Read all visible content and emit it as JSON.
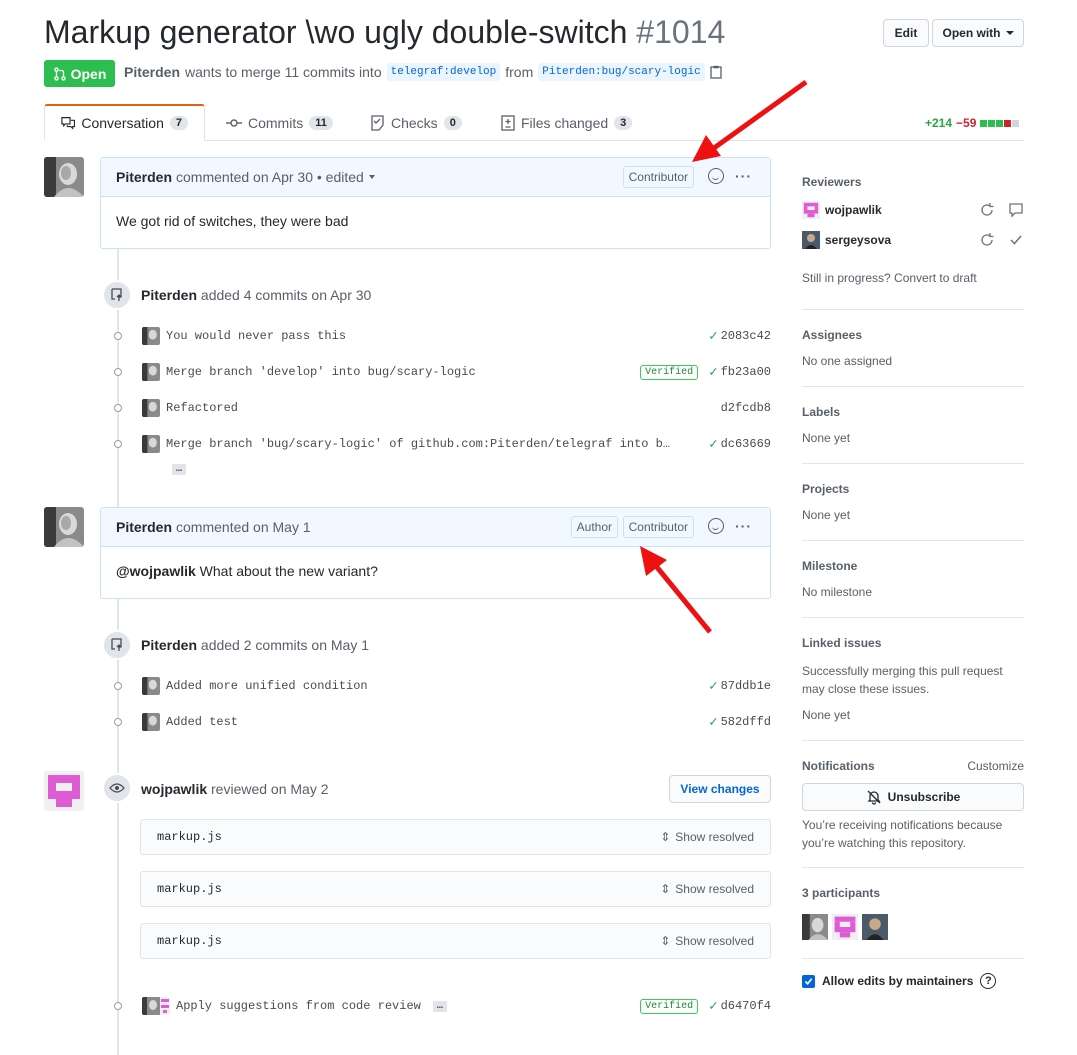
{
  "header": {
    "title": "Markup generator \\wo ugly double-switch",
    "number": "#1014",
    "edit_label": "Edit",
    "open_with_label": "Open with"
  },
  "pr": {
    "state": "Open",
    "author": "Piterden",
    "merge_text": "wants to merge 11 commits into",
    "base_branch": "telegraf:develop",
    "from_text": "from",
    "head_branch": "Piterden:bug/scary-logic"
  },
  "tabs": [
    {
      "label": "Conversation",
      "count": "7"
    },
    {
      "label": "Commits",
      "count": "11"
    },
    {
      "label": "Checks",
      "count": "0"
    },
    {
      "label": "Files changed",
      "count": "3"
    }
  ],
  "diffstat": {
    "additions": "+214",
    "deletions": "−59"
  },
  "timeline": {
    "comment1": {
      "author": "Piterden",
      "meta": "commented on Apr 30 • edited",
      "role": "Contributor",
      "body": "We got rid of switches, they were bad"
    },
    "event1": {
      "author": "Piterden",
      "text": "added 4 commits on Apr 30"
    },
    "commits1": [
      {
        "message": "You would never pass this",
        "sha": "2083c42",
        "verified": "",
        "check": "✓"
      },
      {
        "message": "Merge branch 'develop' into bug/scary-logic",
        "sha": "fb23a00",
        "verified": "Verified",
        "check": "✓"
      },
      {
        "message": "Refactored",
        "sha": "d2fcdb8",
        "verified": "",
        "check": ""
      },
      {
        "message": "Merge branch 'bug/scary-logic' of github.com:Piterden/telegraf into b…",
        "sha": "dc63669",
        "verified": "",
        "check": "✓"
      }
    ],
    "ellipsis": "…",
    "comment2": {
      "author": "Piterden",
      "meta": "commented on May 1",
      "role_author": "Author",
      "role": "Contributor",
      "mention": "@wojpawlik",
      "body": "What about the new variant?"
    },
    "event2": {
      "author": "Piterden",
      "text": "added 2 commits on May 1"
    },
    "commits2": [
      {
        "message": "Added more unified condition",
        "sha": "87ddb1e",
        "check": "✓"
      },
      {
        "message": "Added test",
        "sha": "582dffd",
        "check": "✓"
      }
    ],
    "review": {
      "author": "wojpawlik",
      "text": "reviewed on May 2",
      "view_changes": "View changes",
      "files": [
        "markup.js",
        "markup.js",
        "markup.js"
      ],
      "show_resolved": "Show resolved"
    },
    "final_commit": {
      "message": "Apply suggestions from code review",
      "sha": "d6470f4",
      "verified": "Verified",
      "check": "✓"
    }
  },
  "sidebar": {
    "reviewers_heading": "Reviewers",
    "reviewers": [
      "wojpawlik",
      "sergeysova"
    ],
    "draft_text": "Still in progress? Convert to draft",
    "assignees_heading": "Assignees",
    "assignees_value": "No one assigned",
    "labels_heading": "Labels",
    "labels_value": "None yet",
    "projects_heading": "Projects",
    "projects_value": "None yet",
    "milestone_heading": "Milestone",
    "milestone_value": "No milestone",
    "linked_heading": "Linked issues",
    "linked_text": "Successfully merging this pull request may close these issues.",
    "linked_value": "None yet",
    "notifications_heading": "Notifications",
    "customize": "Customize",
    "unsubscribe": "Unsubscribe",
    "notify_text": "You’re receiving notifications because you’re watching this repository.",
    "participants_heading": "3 participants",
    "allow_edits": "Allow edits by maintainers",
    "help": "?"
  },
  "colors": {
    "open_green": "#2cbe4e",
    "link_blue": "#0366d6",
    "add_green": "#28a745",
    "del_red": "#cb2431",
    "arrow_red": "#ee1111",
    "identicon_pink": "#e05cd6"
  }
}
